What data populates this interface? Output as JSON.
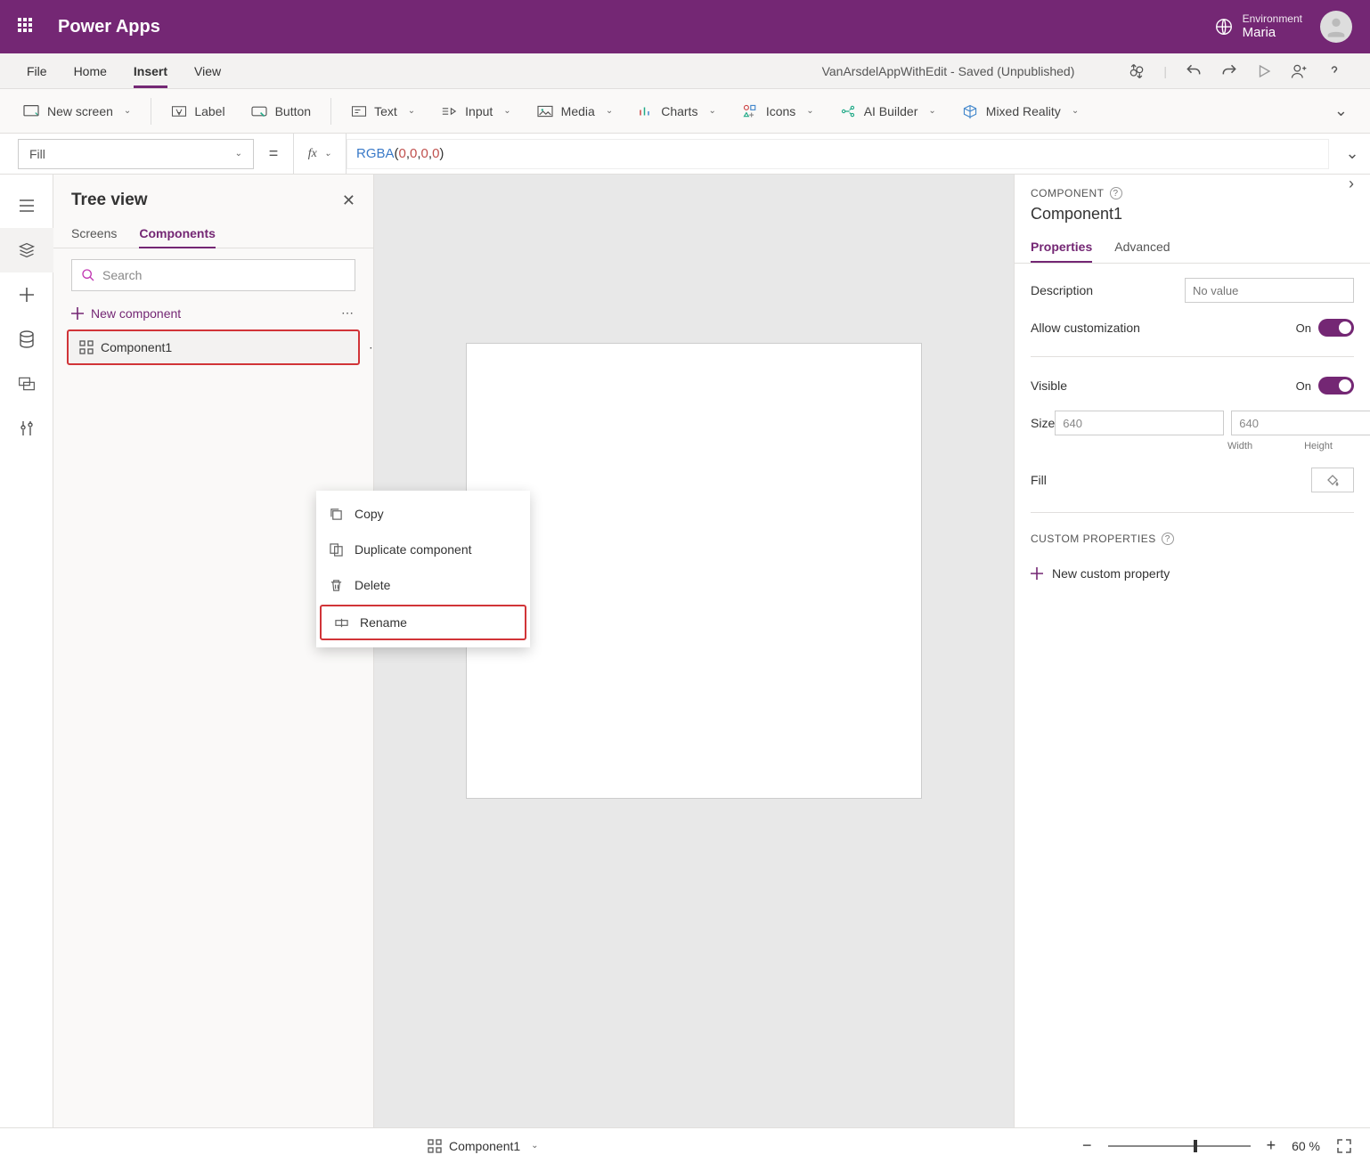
{
  "titlebar": {
    "app_name": "Power Apps",
    "env_label": "Environment",
    "env_name": "Maria"
  },
  "menubar": {
    "items": [
      "File",
      "Home",
      "Insert",
      "View"
    ],
    "active_index": 2,
    "doc_title": "VanArsdelAppWithEdit - Saved (Unpublished)"
  },
  "ribbon": {
    "new_screen": "New screen",
    "label": "Label",
    "button": "Button",
    "text": "Text",
    "input": "Input",
    "media": "Media",
    "charts": "Charts",
    "icons": "Icons",
    "ai_builder": "AI Builder",
    "mixed_reality": "Mixed Reality"
  },
  "formula": {
    "property": "Fill",
    "func": "RGBA",
    "args": [
      "0",
      "0",
      "0",
      "0"
    ]
  },
  "treeview": {
    "title": "Tree view",
    "tabs": [
      "Screens",
      "Components"
    ],
    "active_tab": 1,
    "search_placeholder": "Search",
    "new_component": "New component",
    "item_name": "Component1"
  },
  "contextmenu": {
    "copy": "Copy",
    "duplicate": "Duplicate component",
    "delete": "Delete",
    "rename": "Rename"
  },
  "properties": {
    "header_label": "COMPONENT",
    "component_name": "Component1",
    "tabs": [
      "Properties",
      "Advanced"
    ],
    "active_tab": 0,
    "description_label": "Description",
    "description_placeholder": "No value",
    "allow_customization_label": "Allow customization",
    "allow_customization_state": "On",
    "visible_label": "Visible",
    "visible_state": "On",
    "size_label": "Size",
    "width_value": "640",
    "height_value": "640",
    "width_label": "Width",
    "height_label": "Height",
    "fill_label": "Fill",
    "custom_props_label": "CUSTOM PROPERTIES",
    "new_custom_label": "New custom property"
  },
  "statusbar": {
    "component": "Component1",
    "zoom": "60",
    "zoom_suffix": "%"
  }
}
